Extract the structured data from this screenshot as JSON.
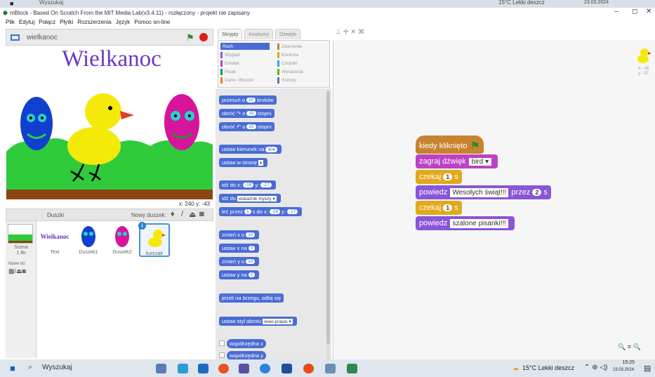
{
  "top_taskbar": {
    "weather": "15°C Lekki deszcz",
    "date": "23.03.2024",
    "search": "Wyszukaj"
  },
  "window": {
    "title": "mBlock - Based On Scratch From the MIT Media Lab(v3.4.11) - rozłączony - projekt nie zapisany",
    "minimize": "–",
    "maximize": "◻",
    "close": "✕"
  },
  "menu": [
    "Plik",
    "Edytuj",
    "Połącz",
    "Płytki",
    "Rozszerzenia",
    "Język",
    "Pomoc on-line"
  ],
  "stage": {
    "project_name": "wielkanoc",
    "heading": "Wielkanoc",
    "coord_x_label": "x:",
    "coord_x": "240",
    "coord_y_label": "y:",
    "coord_y": "-43"
  },
  "sprites_panel": {
    "title": "Duszki",
    "new_sprite": "Nowy duszek:",
    "scene_label": "Scena",
    "scene_sub": "1 tło",
    "new_bg": "Nowe tło:",
    "sprites": [
      {
        "name": "Text",
        "thumb_text": "Wielkanoc"
      },
      {
        "name": "Duszek1"
      },
      {
        "name": "Duszek2"
      },
      {
        "name": "kurczak"
      }
    ]
  },
  "tabs": [
    "Skrypty",
    "Kostiumy",
    "Dźwięki"
  ],
  "categories": [
    {
      "label": "Ruch",
      "color": "#4a6cd4"
    },
    {
      "label": "Zdarzenia",
      "color": "#c88330"
    },
    {
      "label": "Wygląd",
      "color": "#8a55d7"
    },
    {
      "label": "Kontrola",
      "color": "#e1a91a"
    },
    {
      "label": "Dźwięk",
      "color": "#bb42c3"
    },
    {
      "label": "Czujniki",
      "color": "#2ca5e2"
    },
    {
      "label": "Pisak",
      "color": "#0e9a6c"
    },
    {
      "label": "Wyrażenia",
      "color": "#5cb712"
    },
    {
      "label": "Dane i Bloczki",
      "color": "#ee7d16"
    },
    {
      "label": "Roboty",
      "color": "#5e7b9a"
    }
  ],
  "palette": {
    "move_a": "przesuń o",
    "move_n": "10",
    "move_b": "kroków",
    "turn_r_a": "obróć ↷ o",
    "turn_r_n": "15",
    "turn_r_b": "stopni",
    "turn_l_a": "obróć ↶ o",
    "turn_l_n": "15",
    "turn_l_b": "stopni",
    "dir_a": "ustaw kierunek na",
    "dir_n": "90▾",
    "towards_a": "ustaw w stronę",
    "towards_d": "▾",
    "goto_a": "idź do x:",
    "goto_x": "-18",
    "goto_b": "y:",
    "goto_y": "-27",
    "goto2_a": "idź do",
    "goto2_d": "wskaźnik myszy ▾",
    "glide_a": "leć przez",
    "glide_n": "1",
    "glide_b": "s do x:",
    "glide_x": "-18",
    "glide_c": "y:",
    "glide_y": "-27",
    "chx_a": "zmień x o",
    "chx_n": "10",
    "setx_a": "ustaw x na",
    "setx_n": "0",
    "chy_a": "zmień y o",
    "chy_n": "10",
    "sety_a": "ustaw y na",
    "sety_n": "0",
    "bounce": "jeżeli na brzegu, odbij się",
    "rot_a": "ustaw styl obrotu",
    "rot_d": "lewo-prawo ▾",
    "xpos": "współrzędna x",
    "ypos": "współrzędna y"
  },
  "script": {
    "hat": "kiedy kliknięto",
    "sound_a": "zagraj dźwięk",
    "sound_d": "bird ▾",
    "wait1_a": "czekaj",
    "wait1_n": "1",
    "wait1_b": "s",
    "say_a": "powiedz",
    "say_t": "Wesołych świąt!!!",
    "say_b": "przez",
    "say_n": "2",
    "say_c": "s",
    "wait2_a": "czekaj",
    "wait2_n": "1",
    "wait2_b": "s",
    "say2_a": "powiedz",
    "say2_t": "szalone pisanki!!!"
  },
  "mini_sprite": {
    "x": "x: -18",
    "y": "y: -27"
  },
  "zoom": "🔍 = 🔍",
  "bottom_taskbar": {
    "search": "Wyszukaj",
    "weather": "15°C Lekki deszcz",
    "time": "15:25",
    "date": "23.03.2024"
  }
}
